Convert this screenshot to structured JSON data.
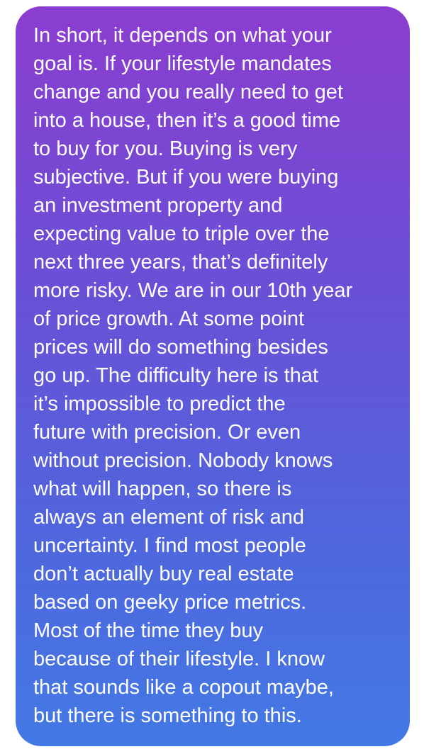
{
  "message": {
    "lines": [
      "In short, it depends on what your",
      "goal is. If your lifestyle mandates",
      "change and you really need to get",
      "into a house, then it’s a good time",
      "to buy for you. Buying is very",
      "subjective. But if you were buying",
      "an investment property and",
      "expecting value to triple over the",
      "next three years, that’s definitely",
      "more risky. We are in our 10th year",
      "of price growth. At some point",
      "prices will do something besides",
      "go up. The difficulty here is that",
      "it’s impossible to predict the",
      "future with precision. Or even",
      "without precision. Nobody knows",
      "what will happen, so there is",
      "always an element of risk and",
      "uncertainty. I find most people",
      "don’t actually buy real estate",
      "based on geeky price metrics.",
      "Most of the time they buy",
      "because of their lifestyle. I know",
      "that sounds like a copout maybe,",
      "but there is something to this."
    ]
  },
  "colors": {
    "bubble_top": "#8b3dcf",
    "bubble_bottom": "#4379e4",
    "text": "#ffffff"
  }
}
